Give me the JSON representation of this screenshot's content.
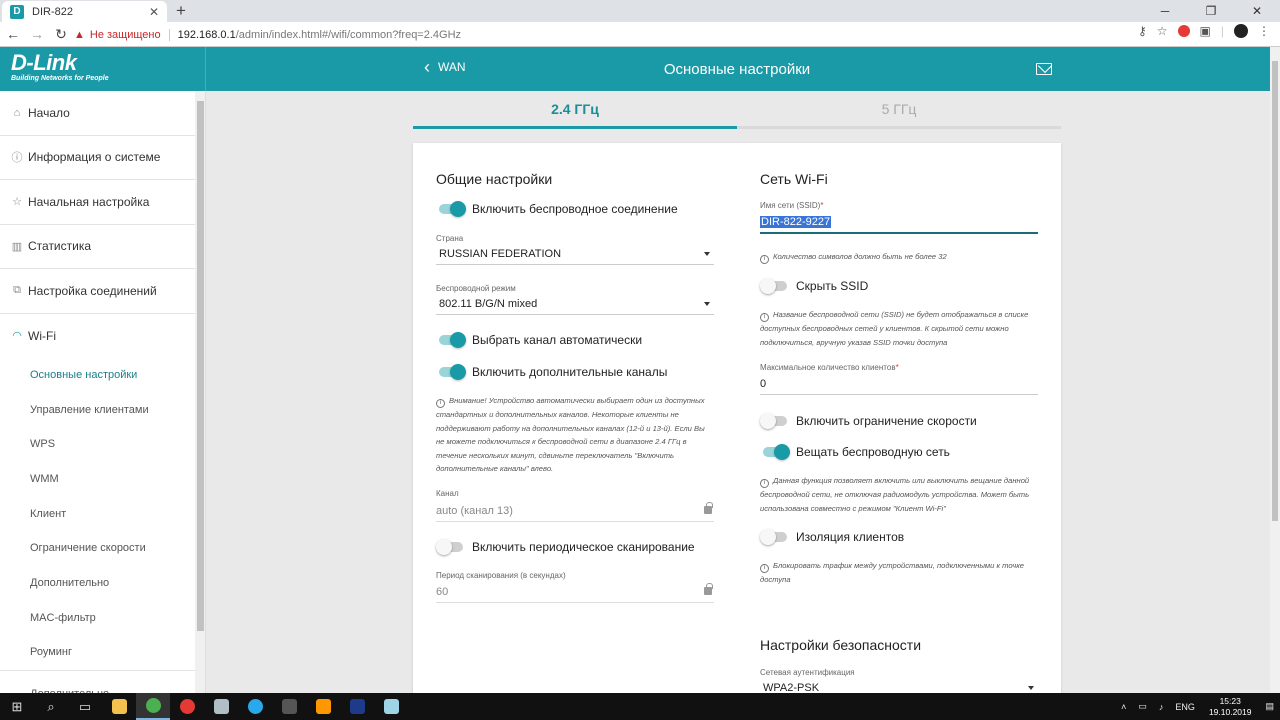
{
  "browser": {
    "tab_title": "DIR-822",
    "tab_favicon": "D",
    "new_tab": "+",
    "window_controls": [
      "─",
      "❐",
      "✕"
    ],
    "not_secure": "Не защищено",
    "url_host": "192.168.0.1",
    "url_path": "/admin/index.html#/wifi/common?freq=2.4GHz"
  },
  "header": {
    "logo_main": "D-Link",
    "logo_sub": "Building Networks for People",
    "back_label": "WAN",
    "title": "Основные настройки"
  },
  "sidebar": {
    "items": [
      {
        "label": "Начало",
        "icon": "home-icon",
        "glyph": "⌂"
      },
      {
        "label": "Информация о системе",
        "icon": "info-icon",
        "glyph": "ⓘ"
      },
      {
        "label": "Начальная настройка",
        "icon": "star-icon",
        "glyph": "☆"
      },
      {
        "label": "Статистика",
        "icon": "chart-icon",
        "glyph": "▥"
      },
      {
        "label": "Настройка соединений",
        "icon": "connections-icon",
        "glyph": "⧉"
      }
    ],
    "wifi": {
      "label": "Wi-Fi",
      "glyph": "◠"
    },
    "wifi_sub": [
      "Основные настройки",
      "Управление клиентами",
      "WPS",
      "WMM",
      "Клиент",
      "Ограничение скорости",
      "Дополнительно",
      "MAC-фильтр",
      "Роуминг"
    ],
    "next_item": "Дополнительно"
  },
  "freq_tabs": {
    "active": "2.4 ГГц",
    "inactive": "5 ГГц"
  },
  "left": {
    "heading": "Общие настройки",
    "enable_wireless": "Включить беспроводное соединение",
    "country_label": "Страна",
    "country_value": "RUSSIAN FEDERATION",
    "mode_label": "Беспроводной режим",
    "mode_value": "802.11 B/G/N mixed",
    "auto_channel": "Выбрать канал автоматически",
    "extra_channels": "Включить дополнительные каналы",
    "note": "Внимание! Устройство автоматически выбирает один из доступных стандартных и дополнительных каналов. Некоторые клиенты не поддерживают работу на дополнительных каналах (12-й и 13-й). Если Вы не можете подключиться к беспроводной сети в диапазоне 2.4 ГГц в течение нескольких минут, сдвиньте переключатель \"Включить дополнительные каналы\" влево.",
    "channel_label": "Канал",
    "channel_value": "auto (канал 13)",
    "periodic_scan": "Включить периодическое сканирование",
    "scan_period_label": "Период сканирования (в секундах)",
    "scan_period_value": "60"
  },
  "right": {
    "heading": "Сеть Wi-Fi",
    "ssid_label": "Имя сети (SSID)",
    "ssid_value": "DIR-822-9227",
    "ssid_note": "Количество символов должно быть не более 32",
    "hide_ssid": "Скрыть SSID",
    "hide_ssid_note": "Название беспроводной сети (SSID) не будет отображаться в списке доступных беспроводных сетей у клиентов. К скрытой сети можно подключиться, вручную указав SSID точки доступа",
    "max_clients_label": "Максимальное количество клиентов",
    "max_clients_value": "0",
    "rate_limit": "Включить ограничение скорости",
    "broadcast": "Вещать беспроводную сеть",
    "broadcast_note": "Данная функция позволяет включить или выключить вещание данной беспроводной сети, не отключая радиомодуль устройства. Может быть использована совместно с режимом \"Клиент Wi-Fi\"",
    "isolation": "Изоляция клиентов",
    "isolation_note": "Блокировать трафик между устройствами, подключенными к точке доступа",
    "security_heading": "Настройки безопасности",
    "auth_label": "Сетевая аутентификация",
    "auth_value": "WPA2-PSK"
  },
  "taskbar": {
    "lang": "ENG",
    "time": "15:23",
    "date": "19.10.2019"
  },
  "colors": {
    "accent": "#1a9aa6",
    "header": "#1a9aa6"
  }
}
